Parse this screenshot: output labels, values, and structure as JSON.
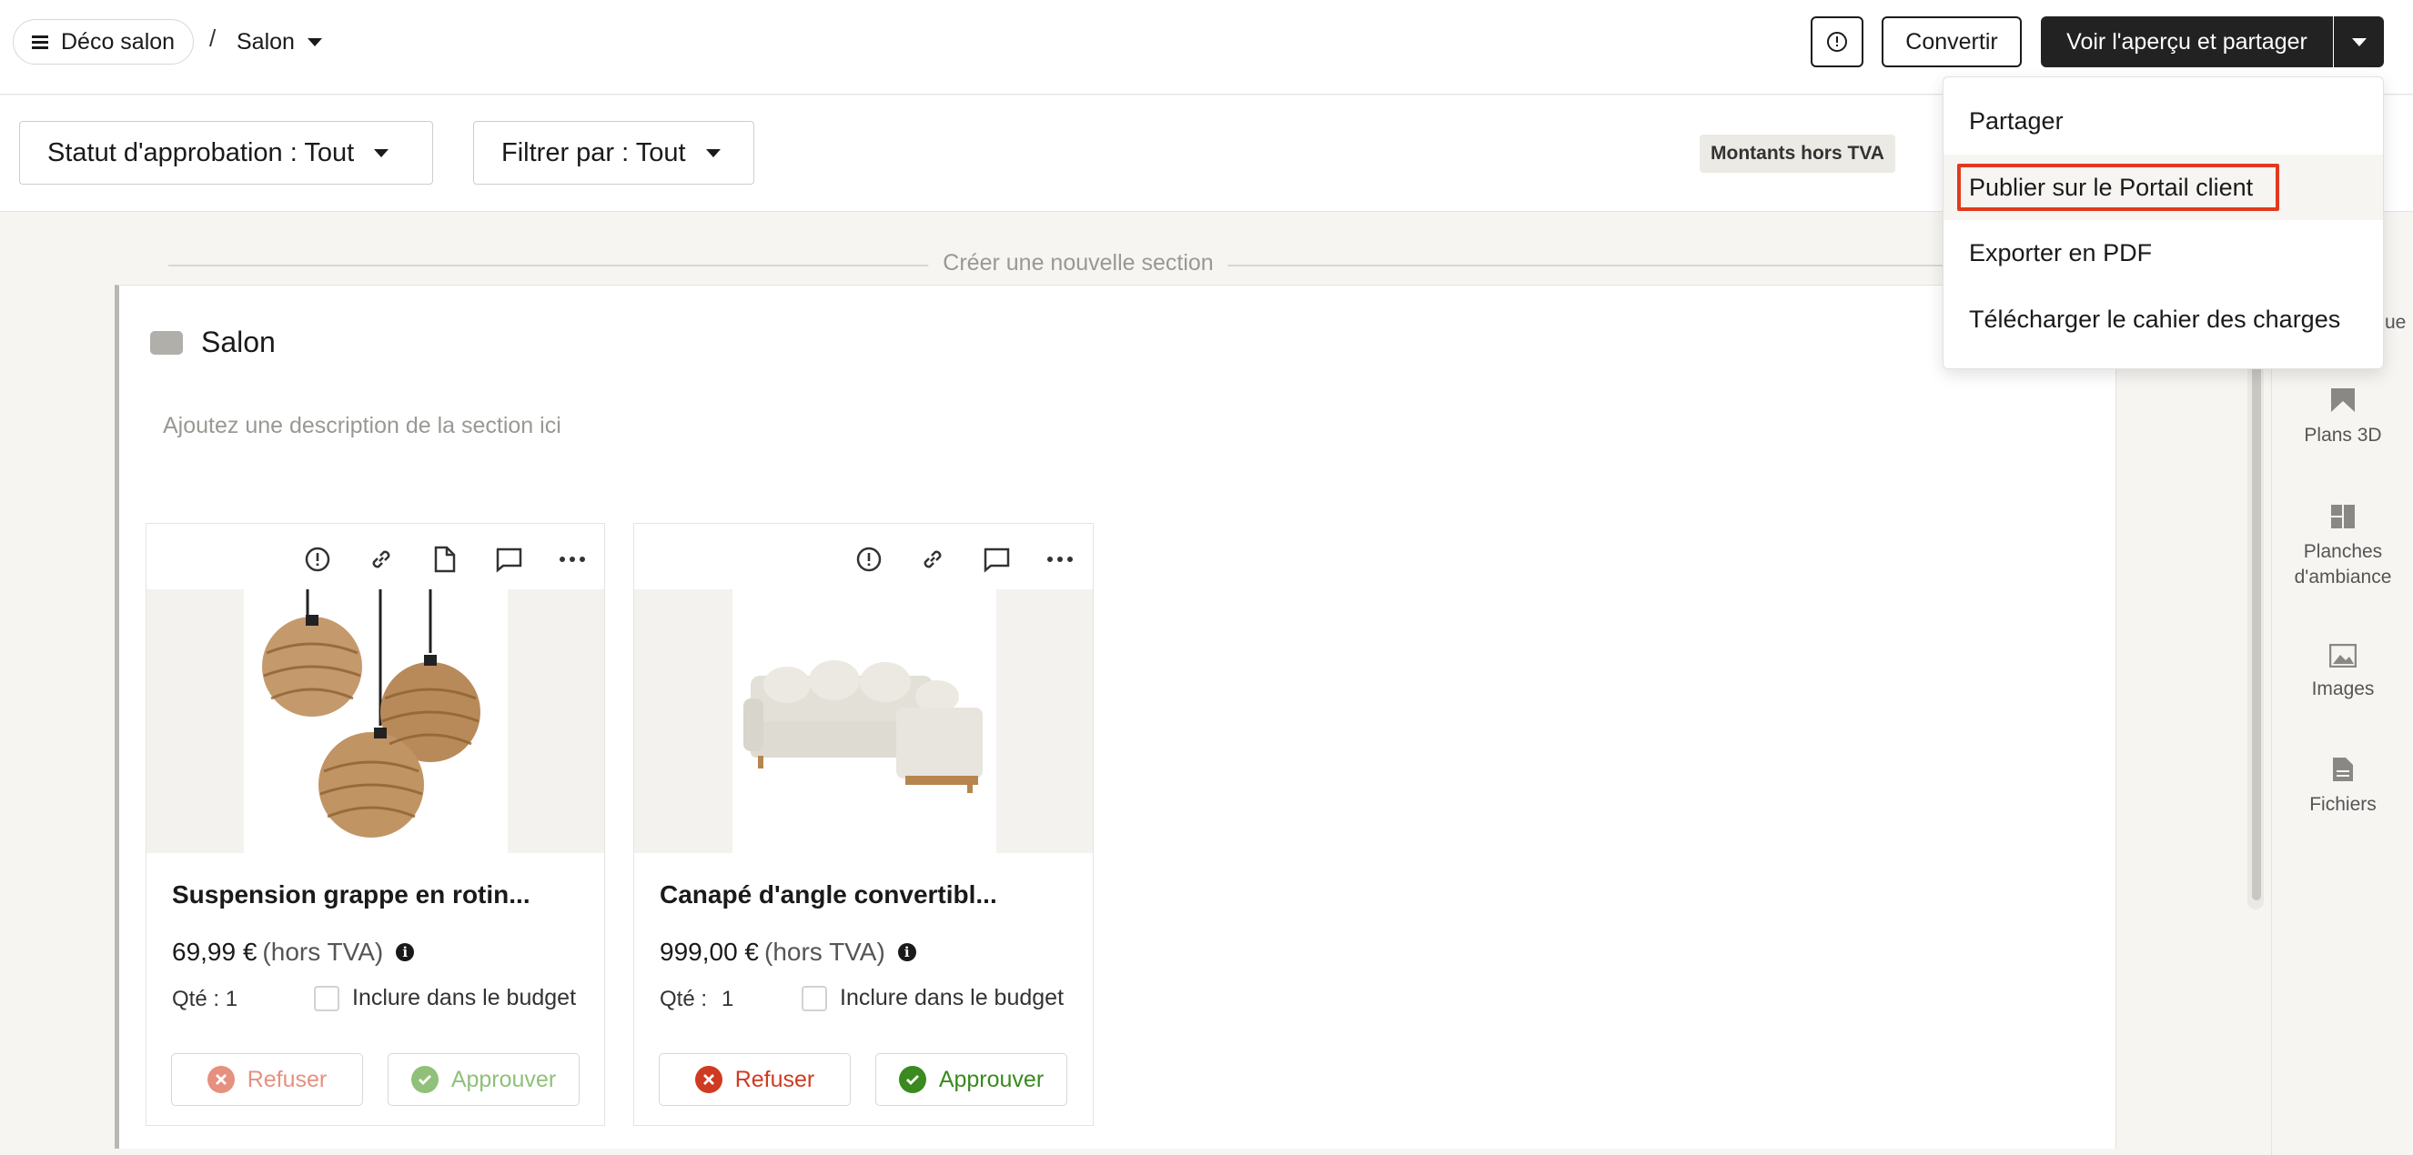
{
  "header": {
    "project_name": "Déco salon",
    "separator": "/",
    "room": "Salon",
    "convert_label": "Convertir",
    "preview_label": "Voir l'aperçu et partager"
  },
  "filters": {
    "approval": "Statut d'approbation : Tout",
    "filter_by": "Filtrer par : Tout",
    "vat_badge": "Montants hors TVA"
  },
  "share_menu": {
    "items": [
      {
        "label": "Partager"
      },
      {
        "label": "Publier sur le Portail client"
      },
      {
        "label": "Exporter en PDF"
      },
      {
        "label": "Télécharger le cahier des charges"
      }
    ]
  },
  "right_panel": {
    "partial_1": "s",
    "partial_2": "ue",
    "items": [
      {
        "label": "Plans 3D",
        "icon": "plans-3d-icon"
      },
      {
        "label": "Planches d'ambiance",
        "icon": "moodboard-icon"
      },
      {
        "label": "Images",
        "icon": "image-icon"
      },
      {
        "label": "Fichiers",
        "icon": "file-icon"
      }
    ]
  },
  "main": {
    "new_section": "Créer une nouvelle section",
    "section": {
      "title": "Salon",
      "description_placeholder": "Ajoutez une description de la section ici"
    },
    "products": [
      {
        "name": "Suspension grappe en rotin...",
        "price": "69,99 €",
        "price_suffix": "(hors TVA)",
        "qty_label": "Qté : 1",
        "qty_value": "",
        "include_budget": "Inclure dans le budget",
        "refuse": "Refuser",
        "approve": "Approuver"
      },
      {
        "name": "Canapé d'angle convertibl...",
        "price": "999,00 €",
        "price_suffix": "(hors TVA)",
        "qty_label": "Qté :",
        "qty_value": "1",
        "include_budget": "Inclure dans le budget",
        "refuse": "Refuser",
        "approve": "Approuver"
      }
    ]
  },
  "colors": {
    "primary_dark": "#222222",
    "refuse_red": "#d03a22",
    "approve_green": "#3a8a1f",
    "highlight_box": "#e03a1e"
  }
}
